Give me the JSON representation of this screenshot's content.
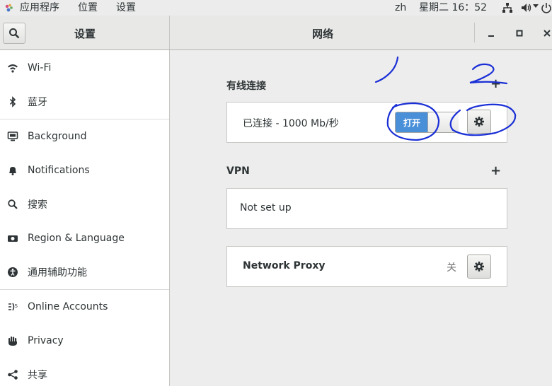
{
  "topbar": {
    "apps": "应用程序",
    "places": "位置",
    "settings": "设置",
    "lang": "zh",
    "clock": "星期二 16：52"
  },
  "headerbar": {
    "left_title": "设置",
    "main_title": "网络"
  },
  "sidebar": {
    "items": [
      {
        "label": "Wi-Fi",
        "icon": "wifi-icon"
      },
      {
        "label": "蓝牙",
        "icon": "bluetooth-icon"
      },
      {
        "label": "Background",
        "icon": "background-icon"
      },
      {
        "label": "Notifications",
        "icon": "bell-icon"
      },
      {
        "label": "搜索",
        "icon": "search-icon"
      },
      {
        "label": "Region & Language",
        "icon": "region-icon"
      },
      {
        "label": "通用辅助功能",
        "icon": "accessibility-icon"
      },
      {
        "label": "Online Accounts",
        "icon": "online-accounts-icon"
      },
      {
        "label": "Privacy",
        "icon": "hand-icon"
      },
      {
        "label": "共享",
        "icon": "share-icon"
      }
    ]
  },
  "wired": {
    "title": "有线连接",
    "status": "已连接 - 1000 Mb/秒",
    "toggle_label": "打开"
  },
  "vpn": {
    "title": "VPN",
    "status": "Not set up"
  },
  "proxy": {
    "title": "Network Proxy",
    "state": "关"
  },
  "annotations": {
    "mark_1": "1",
    "mark_2": "2",
    "color": "#1a2fd6"
  },
  "colors": {
    "accent": "#4a90d9"
  }
}
